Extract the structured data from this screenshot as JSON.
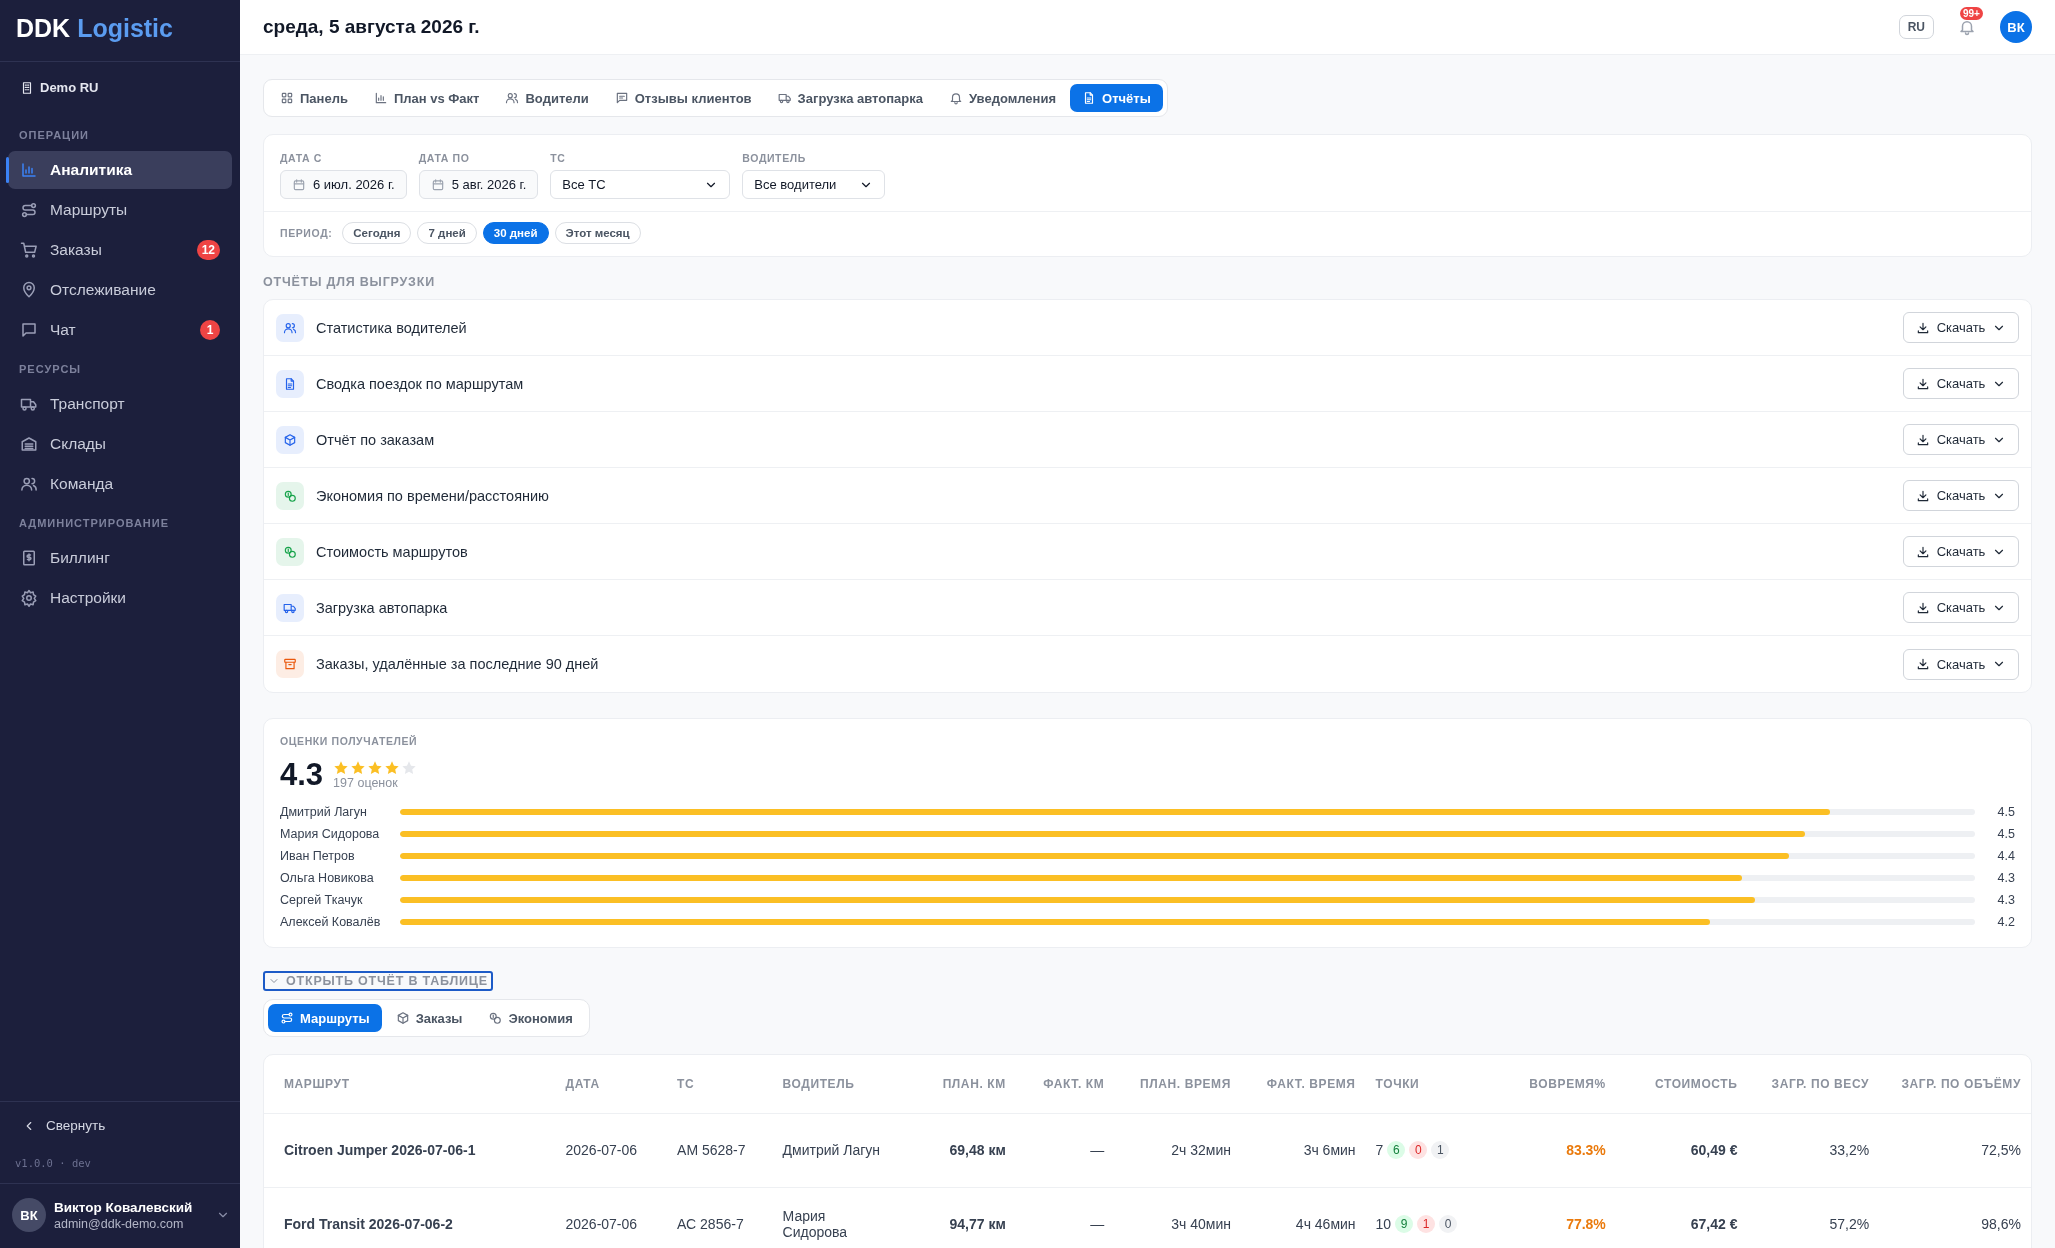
{
  "sidebar": {
    "logo": {
      "primary": "DDK",
      "accent": "Logistic"
    },
    "org": "Demo RU",
    "sections": [
      {
        "title": "ОПЕРАЦИИ",
        "items": [
          {
            "label": "Аналитика",
            "selected": true
          },
          {
            "label": "Маршруты",
            "selected": false
          },
          {
            "label": "Заказы",
            "selected": false,
            "badge": "12"
          },
          {
            "label": "Отслеживание",
            "selected": false
          },
          {
            "label": "Чат",
            "selected": false,
            "badge": "1"
          }
        ]
      },
      {
        "title": "РЕСУРСЫ",
        "items": [
          {
            "label": "Транспорт",
            "selected": false
          },
          {
            "label": "Склады",
            "selected": false
          },
          {
            "label": "Команда",
            "selected": false
          }
        ]
      },
      {
        "title": "АДМИНИСТРИРОВАНИЕ",
        "items": [
          {
            "label": "Биллинг",
            "selected": false
          },
          {
            "label": "Настройки",
            "selected": false
          }
        ]
      }
    ],
    "collapse": "Свернуть",
    "version": "v1.0.0 · dev",
    "user": {
      "initials": "ВК",
      "name": "Виктор Ковалевский",
      "email": "admin@ddk-demo.com"
    }
  },
  "header": {
    "title": "среда, 5 августа 2026 г.",
    "language": "RU",
    "notifications_badge": "99+",
    "avatar": "ВК"
  },
  "tabs": [
    {
      "label": "Панель",
      "selected": false
    },
    {
      "label": "План vs Факт",
      "selected": false
    },
    {
      "label": "Водители",
      "selected": false
    },
    {
      "label": "Отзывы клиентов",
      "selected": false
    },
    {
      "label": "Загрузка автопарка",
      "selected": false
    },
    {
      "label": "Уведомления",
      "selected": false
    },
    {
      "label": "Отчёты",
      "selected": true
    }
  ],
  "filters": {
    "fields": [
      {
        "kind": "date",
        "label": "ДАТА С",
        "value": "6 июл. 2026 г."
      },
      {
        "kind": "date",
        "label": "ДАТА ПО",
        "value": "5 авг. 2026 г."
      },
      {
        "kind": "select",
        "label": "ТС",
        "value": "Все ТС"
      },
      {
        "kind": "select",
        "label": "ВОДИТЕЛЬ",
        "value": "Все водители"
      }
    ],
    "period_label": "ПЕРИОД:",
    "periods": [
      {
        "label": "Сегодня",
        "selected": false
      },
      {
        "label": "7 дней",
        "selected": false
      },
      {
        "label": "30 дней",
        "selected": true
      },
      {
        "label": "Этот месяц",
        "selected": false
      }
    ]
  },
  "reports": {
    "title": "ОТЧЁТЫ ДЛЯ ВЫГРУЗКИ",
    "items": [
      {
        "label": "Статистика водителей",
        "color": "#2563eb",
        "download_label": "Скачать"
      },
      {
        "label": "Сводка поездок по маршрутам",
        "color": "#2563eb",
        "download_label": "Скачать"
      },
      {
        "label": "Отчёт по заказам",
        "color": "#2563eb",
        "download_label": "Скачать"
      },
      {
        "label": "Экономия по времени/расстоянию",
        "color": "#16a34a",
        "download_label": "Скачать"
      },
      {
        "label": "Стоимость маршрутов",
        "color": "#16a34a",
        "download_label": "Скачать"
      },
      {
        "label": "Загрузка автопарка",
        "color": "#2563eb",
        "download_label": "Скачать"
      },
      {
        "label": "Заказы, удалённые за последние 90 дней",
        "color": "#ea580c",
        "download_label": "Скачать"
      }
    ]
  },
  "ratings": {
    "title": "ОЦЕНКИ ПОЛУЧАТЕЛЕЙ",
    "average": "4.3",
    "stars": 4,
    "count": "197 оценок",
    "drivers": [
      {
        "name": "Дмитрий Лагун",
        "level": 0.908,
        "value": "4.5"
      },
      {
        "name": "Мария Сидорова",
        "level": 0.892,
        "value": "4.5"
      },
      {
        "name": "Иван Петров",
        "level": 0.882,
        "value": "4.4"
      },
      {
        "name": "Ольга Новикова",
        "level": 0.852,
        "value": "4.3"
      },
      {
        "name": "Сергей Ткачук",
        "level": 0.86,
        "value": "4.3"
      },
      {
        "name": "Алексей Ковалёв",
        "level": 0.832,
        "value": "4.2"
      }
    ]
  },
  "table_toggle": {
    "label": "ОТКРЫТЬ ОТЧЁТ В ТАБЛИЦЕ",
    "expanded": true
  },
  "table_tabs": [
    {
      "label": "Маршруты",
      "selected": true
    },
    {
      "label": "Заказы",
      "selected": false
    },
    {
      "label": "Экономия",
      "selected": false
    }
  ],
  "table": {
    "columns": [
      "МАРШРУТ",
      "ДАТА",
      "ТС",
      "ВОДИТЕЛЬ",
      "ПЛАН. КМ",
      "ФАКТ. КМ",
      "ПЛАН. ВРЕМЯ",
      "ФАКТ. ВРЕМЯ",
      "ТОЧКИ",
      "ВОВРЕМЯ%",
      "СТОИМОСТЬ",
      "ЗАГР. ПО ВЕСУ",
      "ЗАГР. ПО ОБЪЁМУ"
    ],
    "rows": [
      {
        "route": "Citroen Jumper 2026-07-06-1",
        "date": "2026-07-06",
        "vehicle": "АМ 5628-7",
        "driver": "Дмитрий Лагун",
        "plan_km": "69,48 км",
        "fact_km": "—",
        "plan_time": "2ч 32мин",
        "fact_time": "3ч 6мин",
        "points": {
          "total": "7",
          "badges": [
            {
              "kind": "done",
              "text": "6"
            },
            {
              "kind": "failed",
              "text": "0"
            },
            {
              "kind": "pending",
              "text": "1"
            }
          ]
        },
        "ontime": {
          "text": "83.3%",
          "kind": "warning"
        },
        "cost": "60,49 €",
        "weight_load": "33,2%",
        "volume_load": "72,5%"
      },
      {
        "route": "Ford Transit 2026-07-06-2",
        "date": "2026-07-06",
        "vehicle": "АС 2856-7",
        "driver": "Мария Сидорова",
        "plan_km": "94,77 км",
        "fact_km": "—",
        "plan_time": "3ч 40мин",
        "fact_time": "4ч 46мин",
        "points": {
          "total": "10",
          "badges": [
            {
              "kind": "done",
              "text": "9"
            },
            {
              "kind": "failed",
              "text": "1"
            },
            {
              "kind": "pending",
              "text": "0"
            }
          ]
        },
        "ontime": {
          "text": "77.8%",
          "kind": "warning"
        },
        "cost": "67,42 €",
        "weight_load": "57,2%",
        "volume_load": "98,6%"
      }
    ]
  }
}
